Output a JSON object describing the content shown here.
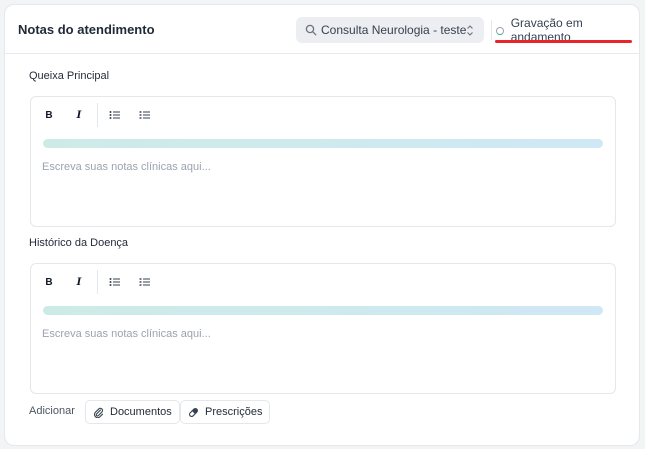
{
  "header": {
    "title": "Notas do atendimento",
    "session_select": {
      "value": "Consulta Neurologia - teste",
      "icon": "search-icon",
      "chevron": "updown-chevron-icon"
    },
    "recording": {
      "label": "Gravação em andamento",
      "indicator_color": "#2bb39a",
      "underline_color": "#e8262a"
    }
  },
  "sections": [
    {
      "label": "Queixa Principal",
      "toolbar": {
        "bold": "B",
        "italic": "I"
      },
      "placeholder": "Escreva suas notas clínicas aqui..."
    },
    {
      "label": "Histórico da Doença",
      "toolbar": {
        "bold": "B",
        "italic": "I"
      },
      "placeholder": "Escreva suas notas clínicas aqui..."
    }
  ],
  "footer": {
    "add_label": "Adicionar",
    "documents_label": "Documentos",
    "prescriptions_label": "Prescrições"
  }
}
